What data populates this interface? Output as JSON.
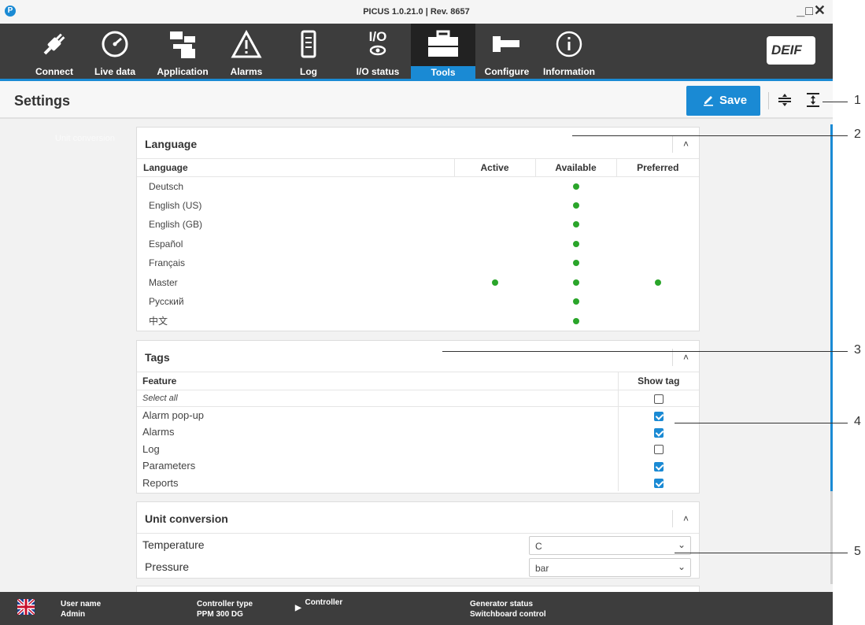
{
  "titlebar": {
    "title": "PICUS 1.0.21.0 | Rev. 8657"
  },
  "nav": {
    "items": [
      {
        "label": "Connect",
        "icon": "plug-icon"
      },
      {
        "label": "Live data",
        "icon": "gauge-icon"
      },
      {
        "label": "Application",
        "icon": "application-icon"
      },
      {
        "label": "Alarms",
        "icon": "warning-icon"
      },
      {
        "label": "Log",
        "icon": "log-icon"
      },
      {
        "label": "I/O status",
        "icon": "io-status-icon"
      },
      {
        "label": "Tools",
        "icon": "toolbox-icon"
      },
      {
        "label": "Configure",
        "icon": "wrench-icon"
      },
      {
        "label": "Information",
        "icon": "info-icon"
      }
    ],
    "active": "Tools",
    "brand": "DEIF"
  },
  "header": {
    "title": "Settings",
    "save_label": "Save"
  },
  "sidebar": {
    "link": "Unit conversion"
  },
  "language_panel": {
    "title": "Language",
    "columns": [
      "Language",
      "Active",
      "Available",
      "Preferred"
    ],
    "rows": [
      {
        "name": "Deutsch",
        "active": false,
        "available": true,
        "preferred": false
      },
      {
        "name": "English (US)",
        "active": false,
        "available": true,
        "preferred": false
      },
      {
        "name": "English (GB)",
        "active": false,
        "available": true,
        "preferred": false
      },
      {
        "name": "Español",
        "active": false,
        "available": true,
        "preferred": false
      },
      {
        "name": "Français",
        "active": false,
        "available": true,
        "preferred": false
      },
      {
        "name": "Master",
        "active": true,
        "available": true,
        "preferred": true
      },
      {
        "name": "Русский",
        "active": false,
        "available": true,
        "preferred": false
      },
      {
        "name": "中文",
        "active": false,
        "available": true,
        "preferred": false
      }
    ]
  },
  "tags_panel": {
    "title": "Tags",
    "columns": [
      "Feature",
      "Show tag"
    ],
    "select_all": "Select all",
    "rows": [
      {
        "name": "Alarm pop-up",
        "checked": true
      },
      {
        "name": "Alarms",
        "checked": true
      },
      {
        "name": "Log",
        "checked": false
      },
      {
        "name": "Parameters",
        "checked": true
      },
      {
        "name": "Reports",
        "checked": true
      }
    ]
  },
  "unit_panel": {
    "title": "Unit conversion",
    "rows": [
      {
        "label": "Temperature",
        "value": "C"
      },
      {
        "label": "Pressure",
        "value": "bar"
      }
    ]
  },
  "status": {
    "user_label": "User name",
    "user_value": "Admin",
    "ctype_label": "Controller type",
    "ctype_value": "PPM 300 DG",
    "controller_label": "Controller",
    "gen_label": "Generator status",
    "gen_value": "Switchboard control"
  },
  "callouts": [
    "1",
    "2",
    "3",
    "4",
    "5"
  ],
  "colors": {
    "accent": "#1a8ad4",
    "nav_bg": "#3d3d3d",
    "status_ok": "#2aa52a"
  }
}
